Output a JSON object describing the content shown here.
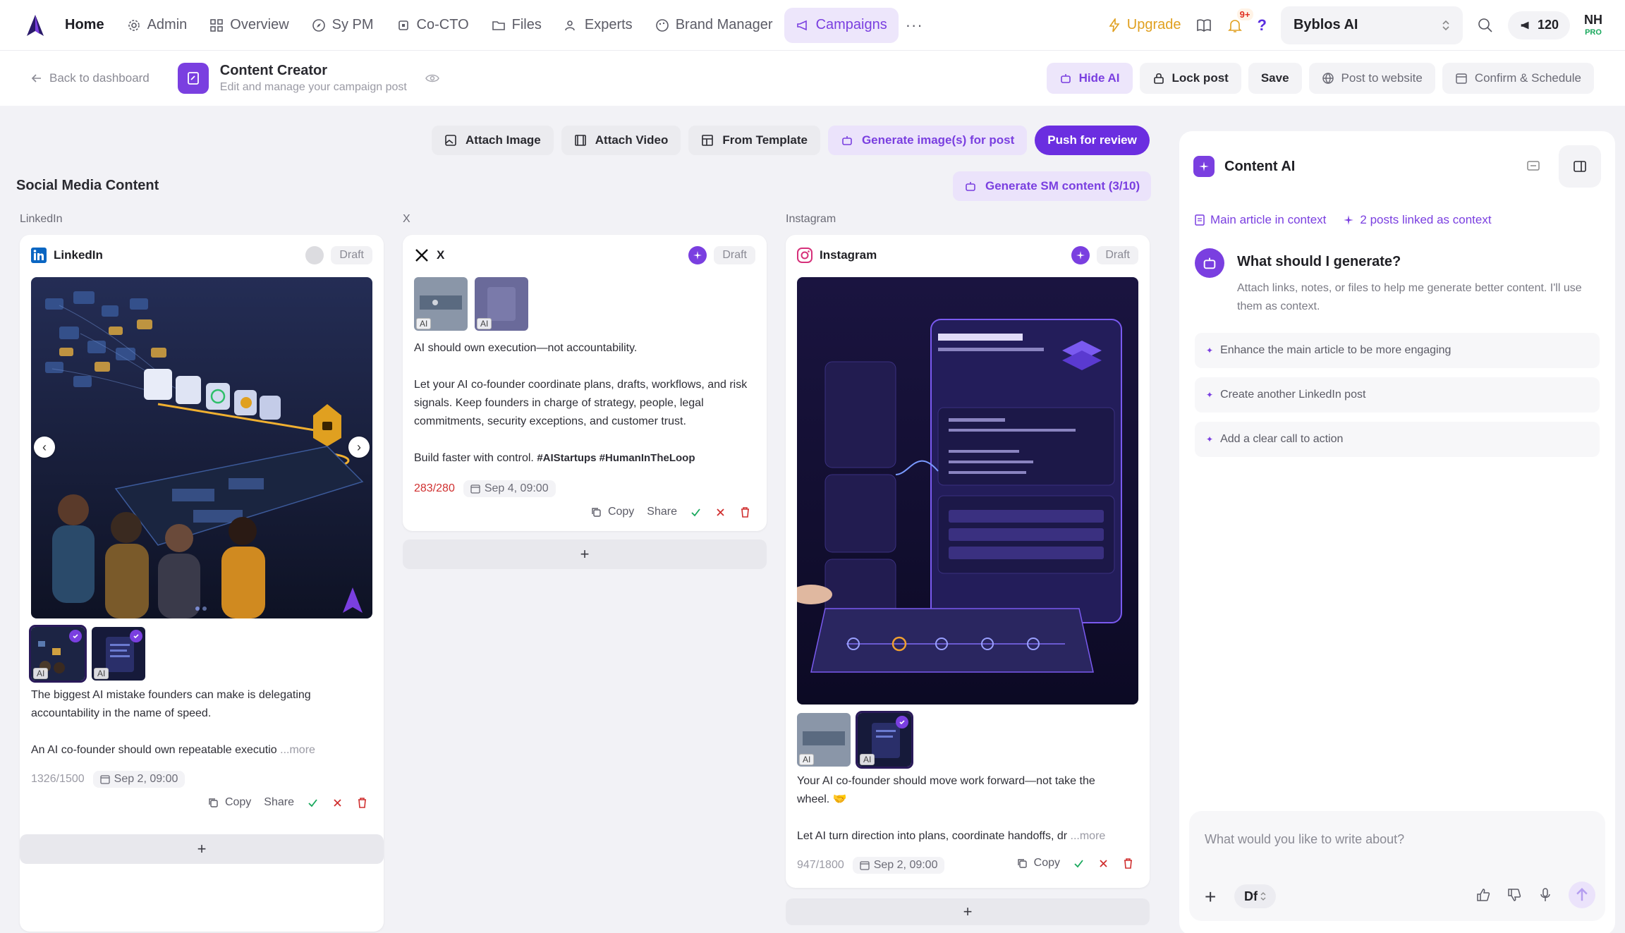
{
  "nav": {
    "items": [
      {
        "label": "Home"
      },
      {
        "label": "Admin"
      },
      {
        "label": "Overview"
      },
      {
        "label": "Sy PM"
      },
      {
        "label": "Co-CTO"
      },
      {
        "label": "Files"
      },
      {
        "label": "Experts"
      },
      {
        "label": "Brand Manager"
      },
      {
        "label": "Campaigns"
      }
    ],
    "more": "···",
    "upgrade": "Upgrade",
    "notifications_badge": "9+",
    "help": "?",
    "org": "Byblos AI",
    "credits": "120",
    "user_initials": "NH",
    "user_plan": "PRO"
  },
  "subheader": {
    "back": "Back to dashboard",
    "title": "Content Creator",
    "subtitle": "Edit and manage your campaign post",
    "hide_ai": "Hide AI",
    "lock_post": "Lock post",
    "save": "Save",
    "post_to_website": "Post to website",
    "confirm_schedule": "Confirm & Schedule"
  },
  "toolbar": {
    "attach_image": "Attach Image",
    "attach_video": "Attach Video",
    "from_template": "From Template",
    "generate_images": "Generate image(s) for post",
    "push_review": "Push for review"
  },
  "section": {
    "title": "Social Media Content",
    "generate_sm": "Generate SM content (3/10)"
  },
  "cards": {
    "linkedin": {
      "column": "LinkedIn",
      "name": "LinkedIn",
      "status": "Draft",
      "text1": "The biggest AI mistake founders can make is delegating accountability in the name of speed.",
      "text2": "An AI co-founder should own repeatable executio",
      "more": "...more",
      "count": "1326/1500",
      "date": "Sep 2, 09:00",
      "copy": "Copy",
      "share": "Share",
      "ai_tag": "AI"
    },
    "x": {
      "column": "X",
      "name": "X",
      "status": "Draft",
      "p1": "AI should own execution—not accountability.",
      "p2": "Let your AI co-founder coordinate plans, drafts, workflows, and risk signals. Keep founders in charge of strategy, people, legal commitments, security exceptions, and customer trust.",
      "p3": "Build faster with control.",
      "hashtags": "#AIStartups #HumanInTheLoop",
      "count": "283/280",
      "date": "Sep 4, 09:00",
      "copy": "Copy",
      "share": "Share",
      "ai_tag": "AI"
    },
    "instagram": {
      "column": "Instagram",
      "name": "Instagram",
      "status": "Draft",
      "text1": "Your AI co-founder should move work forward—not take the wheel. 🤝",
      "text2": "Let AI turn direction into plans, coordinate handoffs, dr",
      "more": "...more",
      "count": "947/1800",
      "date": "Sep 2, 09:00",
      "copy": "Copy",
      "ai_tag": "AI"
    },
    "add": "+"
  },
  "ai": {
    "title": "Content AI",
    "ctx_article": "Main article in context",
    "ctx_posts": "2 posts linked as context",
    "question": "What should I generate?",
    "desc": "Attach links, notes, or files to help me generate better content. I'll use them as context.",
    "suggestions": [
      "Enhance the main article to be more engaging",
      "Create another LinkedIn post",
      "Add a clear call to action"
    ],
    "placeholder": "What would you like to write about?",
    "model": "Df"
  },
  "colors": {
    "accent": "#7a3fe0",
    "primary_button": "#6b2ee0",
    "upgrade": "#e0a020",
    "danger": "#d03030",
    "success": "#18a85c"
  },
  "icons": {
    "home": "logo-icon",
    "admin": "gear-icon",
    "overview": "grid-icon",
    "sypm": "compass-icon",
    "cocto": "chip-icon",
    "files": "folder-icon",
    "experts": "people-icon",
    "brand": "palette-icon",
    "campaigns": "megaphone-icon"
  }
}
